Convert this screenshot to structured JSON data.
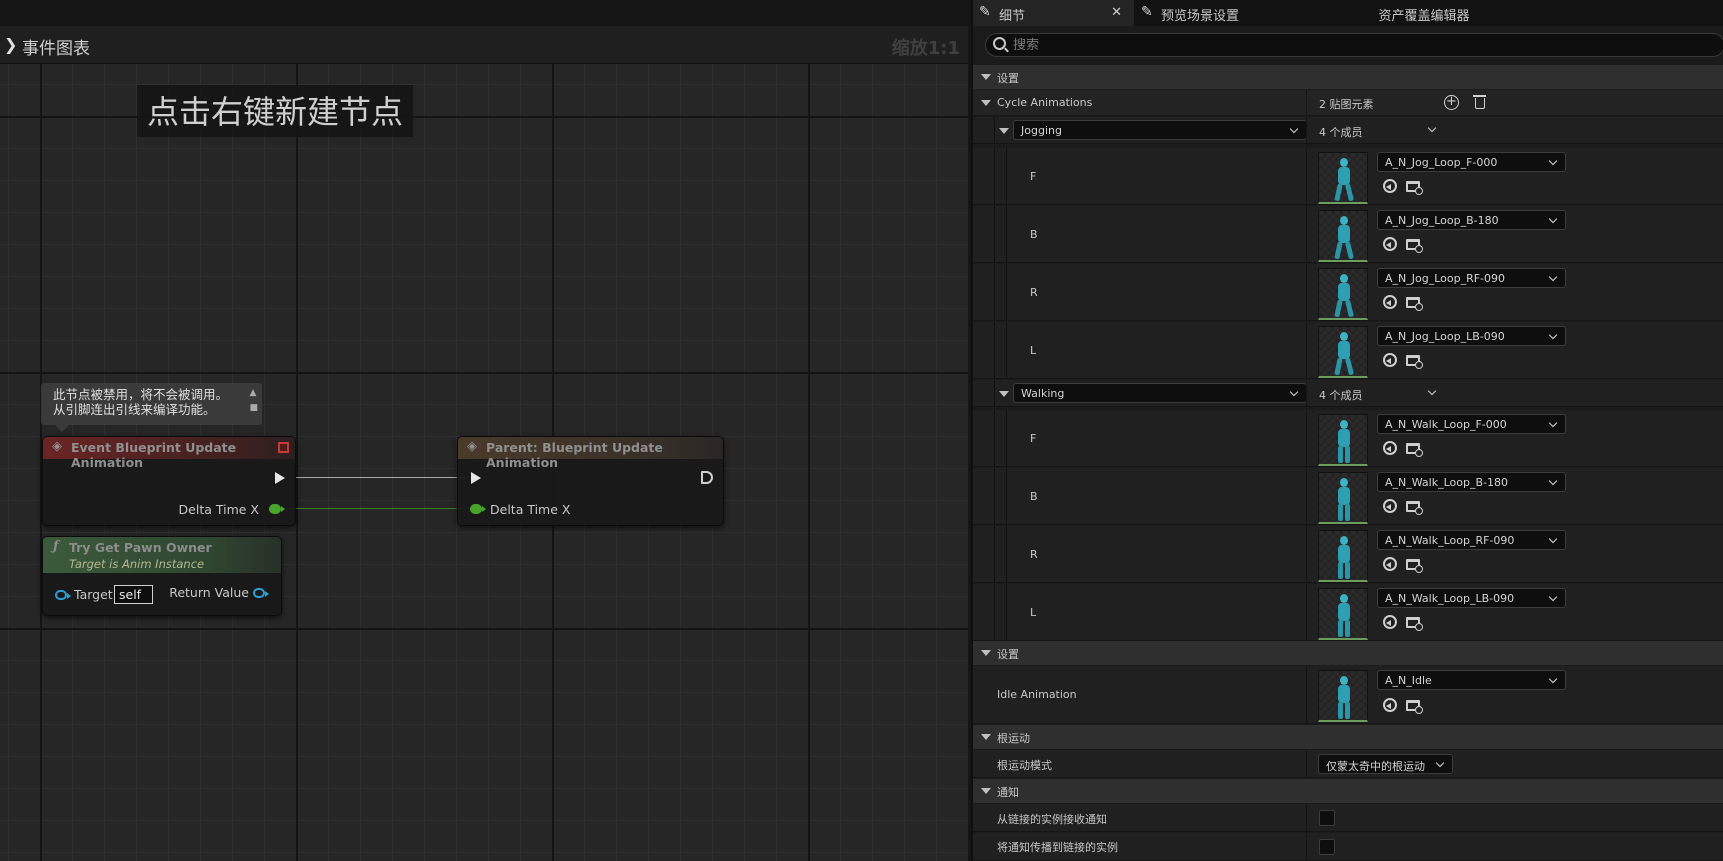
{
  "graph": {
    "title": "事件图表",
    "zoom": "缩放1:1",
    "hint": "点击右键新建节点",
    "comment": {
      "line1": "此节点被禁用，将不会被调用。",
      "line2": "从引脚连出引线来编译功能。"
    },
    "nodes": {
      "event": {
        "title": "Event Blueprint Update Animation",
        "pin": "Delta Time X"
      },
      "parent": {
        "title": "Parent: Blueprint Update Animation",
        "pin": "Delta Time X"
      },
      "pawn": {
        "title": "Try Get Pawn Owner",
        "subtitle": "Target is Anim Instance",
        "target_label": "Target",
        "target_value": "self",
        "return_label": "Return Value"
      }
    }
  },
  "panel": {
    "tabs": [
      {
        "label": "细节",
        "icon": "brush-icon"
      },
      {
        "label": "预览场景设置",
        "icon": "brush-icon"
      },
      {
        "label": "资产覆盖编辑器"
      }
    ],
    "search_placeholder": "搜索",
    "sections": {
      "settings1": "设置",
      "settings2": "设置",
      "root_motion": "根运动",
      "notify": "通知"
    },
    "cycle": {
      "label": "Cycle Animations",
      "count": "2 贴图元素",
      "groups": [
        {
          "name": "Jogging",
          "count": "4 个成员",
          "items": [
            {
              "key": "F",
              "asset": "A_N_Jog_Loop_F-000"
            },
            {
              "key": "B",
              "asset": "A_N_Jog_Loop_B-180"
            },
            {
              "key": "R",
              "asset": "A_N_Jog_Loop_RF-090"
            },
            {
              "key": "L",
              "asset": "A_N_Jog_Loop_LB-090"
            }
          ]
        },
        {
          "name": "Walking",
          "count": "4 个成员",
          "items": [
            {
              "key": "F",
              "asset": "A_N_Walk_Loop_F-000"
            },
            {
              "key": "B",
              "asset": "A_N_Walk_Loop_B-180"
            },
            {
              "key": "R",
              "asset": "A_N_Walk_Loop_RF-090"
            },
            {
              "key": "L",
              "asset": "A_N_Walk_Loop_LB-090"
            }
          ]
        }
      ]
    },
    "idle": {
      "label": "Idle Animation",
      "asset": "A_N_Idle"
    },
    "root_motion_mode": {
      "label": "根运动模式",
      "value": "仅蒙太奇中的根运动"
    },
    "notify_rows": [
      {
        "label": "从链接的实例接收通知",
        "checked": false
      },
      {
        "label": "将通知传播到链接的实例",
        "checked": false
      }
    ]
  }
}
